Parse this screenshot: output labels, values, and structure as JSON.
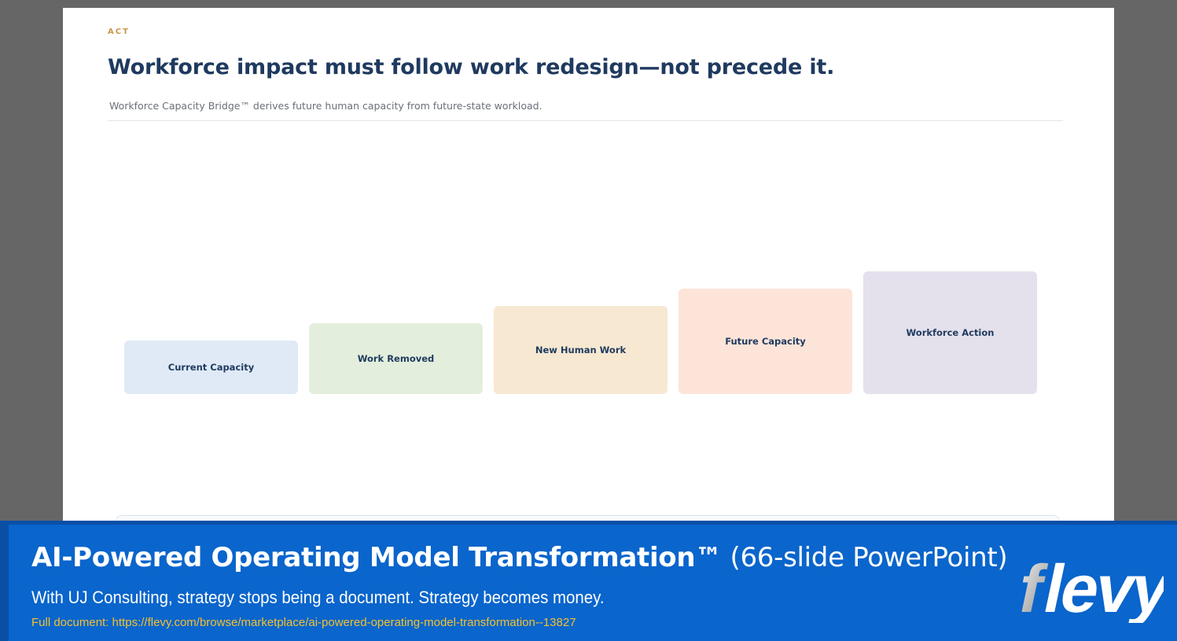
{
  "slide": {
    "eyebrow": "ACT",
    "title": "Workforce impact must follow work redesign—not precede it.",
    "subtitle": "Workforce Capacity Bridge™ derives future human capacity from future-state workload.",
    "cards": [
      {
        "label": "Current Capacity",
        "color": "#dfeaf6"
      },
      {
        "label": "Work Removed",
        "color": "#e3efdc"
      },
      {
        "label": "New Human Work",
        "color": "#f6e8d1"
      },
      {
        "label": "Future Capacity",
        "color": "#fde4d8"
      },
      {
        "label": "Workforce Action",
        "color": "#e4e0ec"
      }
    ]
  },
  "banner": {
    "title_bold": "AI-Powered Operating Model Transformation™",
    "title_light": " (66-slide PowerPoint)",
    "tagline": "With UJ Consulting, strategy stops being a document. Strategy becomes money.",
    "link": "Full document: https://flevy.com/browse/marketplace/ai-powered-operating-model-transformation--13827",
    "logo_text": "flevy",
    "background_color": "#0a65cc",
    "link_color": "#f2c230"
  }
}
